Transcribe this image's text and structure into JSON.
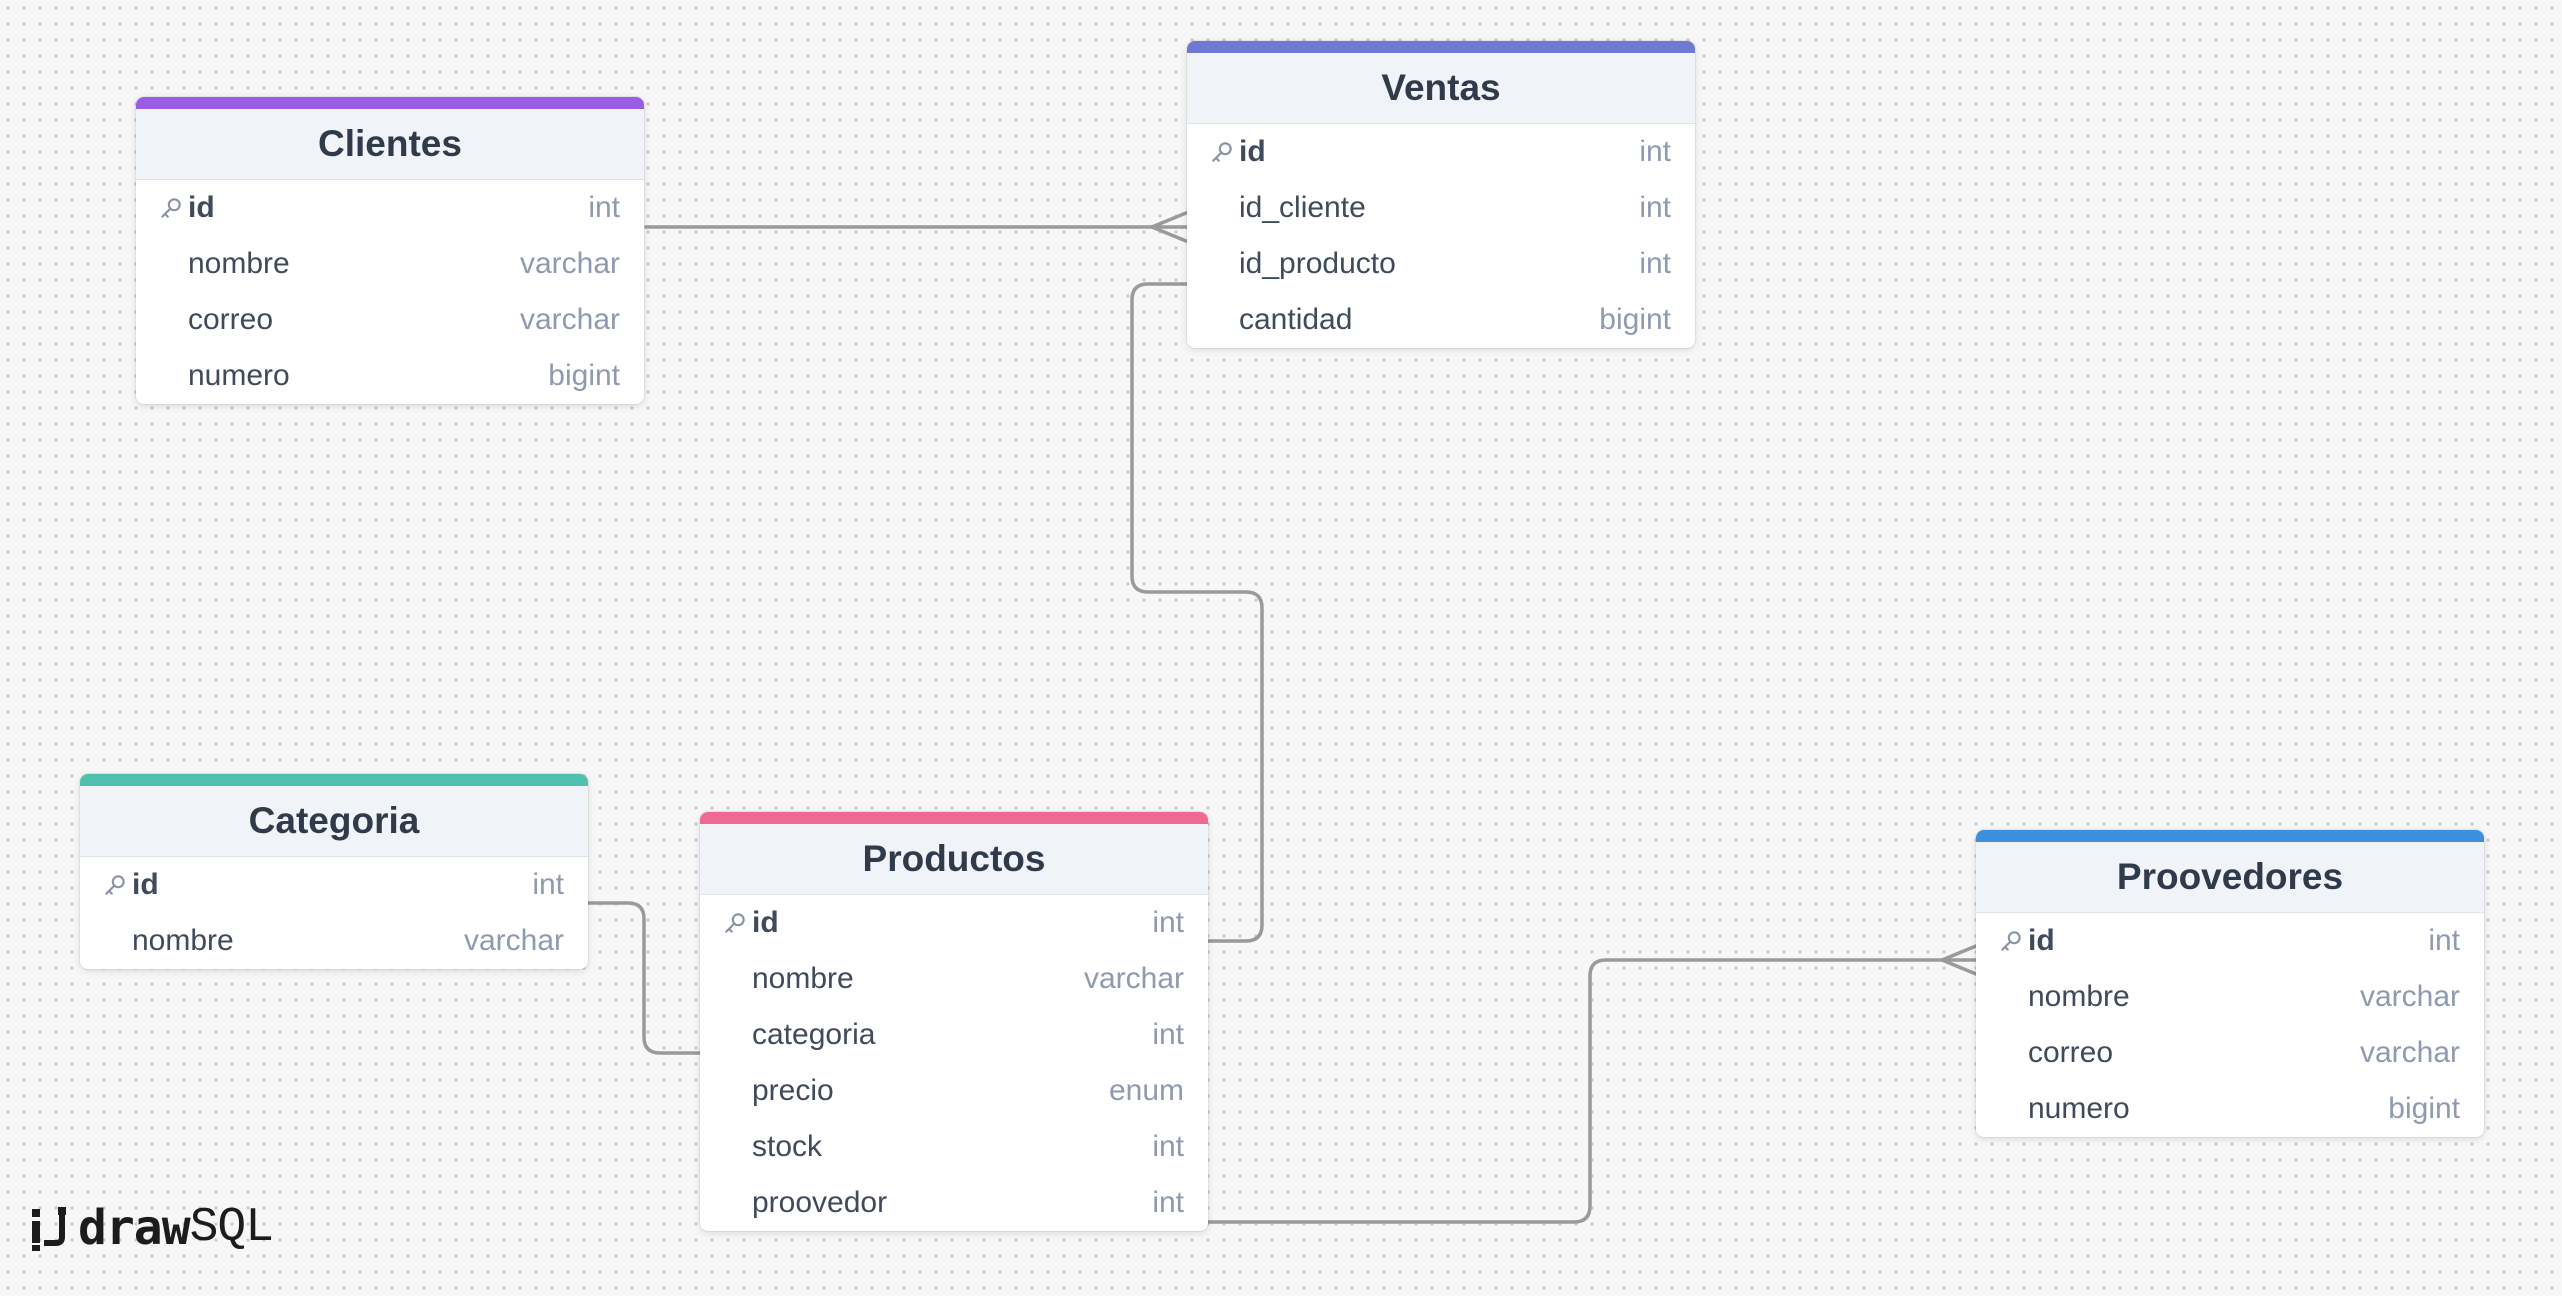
{
  "app": {
    "logo_text_bold": "draw",
    "logo_text_light": "SQL"
  },
  "colors": {
    "clientes": "#9b5de5",
    "ventas": "#6f78d2",
    "categoria": "#4fbfae",
    "productos": "#ef6a92",
    "proovedores": "#3b8fdc",
    "connector": "#9a9a9a"
  },
  "tables": {
    "clientes": {
      "title": "Clientes",
      "columns": [
        {
          "name": "id",
          "type": "int",
          "pk": true
        },
        {
          "name": "nombre",
          "type": "varchar",
          "pk": false
        },
        {
          "name": "correo",
          "type": "varchar",
          "pk": false
        },
        {
          "name": "numero",
          "type": "bigint",
          "pk": false
        }
      ]
    },
    "ventas": {
      "title": "Ventas",
      "columns": [
        {
          "name": "id",
          "type": "int",
          "pk": true
        },
        {
          "name": "id_cliente",
          "type": "int",
          "pk": false
        },
        {
          "name": "id_producto",
          "type": "int",
          "pk": false
        },
        {
          "name": "cantidad",
          "type": "bigint",
          "pk": false
        }
      ]
    },
    "categoria": {
      "title": "Categoria",
      "columns": [
        {
          "name": "id",
          "type": "int",
          "pk": true
        },
        {
          "name": "nombre",
          "type": "varchar",
          "pk": false
        }
      ]
    },
    "productos": {
      "title": "Productos",
      "columns": [
        {
          "name": "id",
          "type": "int",
          "pk": true
        },
        {
          "name": "nombre",
          "type": "varchar",
          "pk": false
        },
        {
          "name": "categoria",
          "type": "int",
          "pk": false
        },
        {
          "name": "precio",
          "type": "enum",
          "pk": false
        },
        {
          "name": "stock",
          "type": "int",
          "pk": false
        },
        {
          "name": "proovedor",
          "type": "int",
          "pk": false
        }
      ]
    },
    "proovedores": {
      "title": "Proovedores",
      "columns": [
        {
          "name": "id",
          "type": "int",
          "pk": true
        },
        {
          "name": "nombre",
          "type": "varchar",
          "pk": false
        },
        {
          "name": "correo",
          "type": "varchar",
          "pk": false
        },
        {
          "name": "numero",
          "type": "bigint",
          "pk": false
        }
      ]
    }
  },
  "relations": [
    {
      "from": "clientes.id",
      "to": "ventas.id_cliente",
      "end": "many"
    },
    {
      "from": "productos.id",
      "to": "ventas.id_producto",
      "end": "one"
    },
    {
      "from": "categoria.id",
      "to": "productos.categoria",
      "end": "one"
    },
    {
      "from": "productos.proovedor",
      "to": "proovedores.id",
      "end": "many"
    }
  ]
}
